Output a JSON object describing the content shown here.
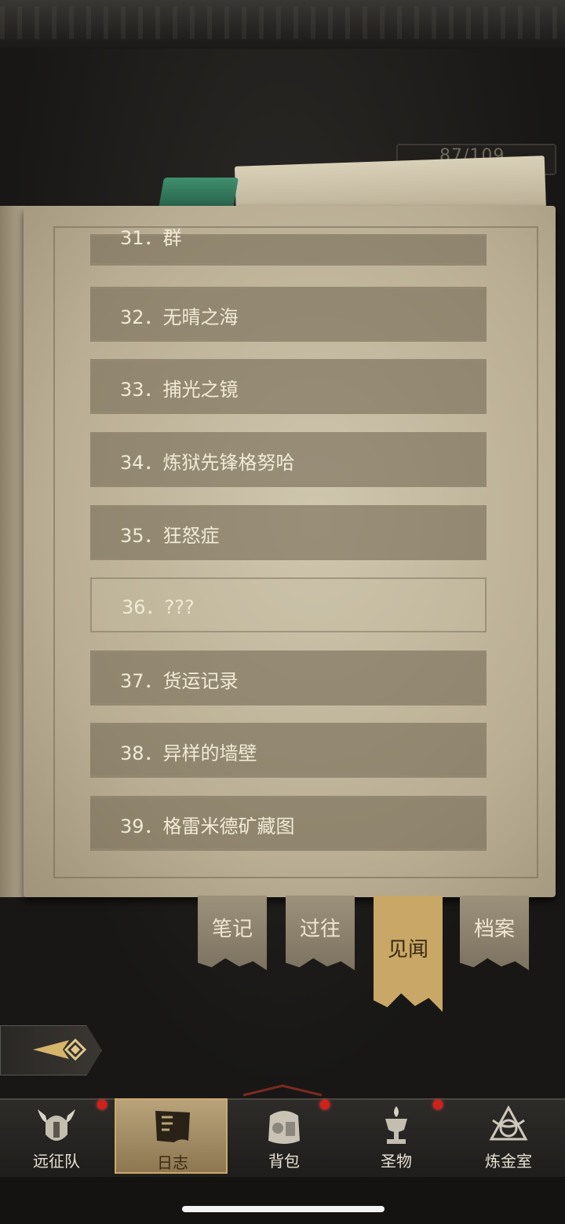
{
  "counter": "87/109",
  "entries": [
    {
      "label": "31．群",
      "state": "partial"
    },
    {
      "label": "32．无晴之海",
      "state": "unlocked"
    },
    {
      "label": "33．捕光之镜",
      "state": "unlocked"
    },
    {
      "label": "34．炼狱先锋格努哈",
      "state": "unlocked"
    },
    {
      "label": "35．狂怒症",
      "state": "unlocked"
    },
    {
      "label": "36．???",
      "state": "locked"
    },
    {
      "label": "37．货运记录",
      "state": "unlocked"
    },
    {
      "label": "38．异样的墙壁",
      "state": "unlocked"
    },
    {
      "label": "39．格雷米德矿藏图",
      "state": "unlocked"
    }
  ],
  "tabs": [
    {
      "label": "笔记",
      "active": false
    },
    {
      "label": "过往",
      "active": false
    },
    {
      "label": "见闻",
      "active": true
    },
    {
      "label": "档案",
      "active": false
    }
  ],
  "nav": [
    {
      "label": "远征队",
      "icon": "viking-helmet-icon",
      "badge": true,
      "active": false
    },
    {
      "label": "日志",
      "icon": "journal-flag-icon",
      "badge": false,
      "active": true
    },
    {
      "label": "背包",
      "icon": "backpack-icon",
      "badge": true,
      "active": false
    },
    {
      "label": "圣物",
      "icon": "chalice-icon",
      "badge": true,
      "active": false
    },
    {
      "label": "炼金室",
      "icon": "alchemy-icon",
      "badge": false,
      "active": false
    }
  ],
  "colors": {
    "accent": "#c9a767",
    "badge": "#d32018"
  }
}
